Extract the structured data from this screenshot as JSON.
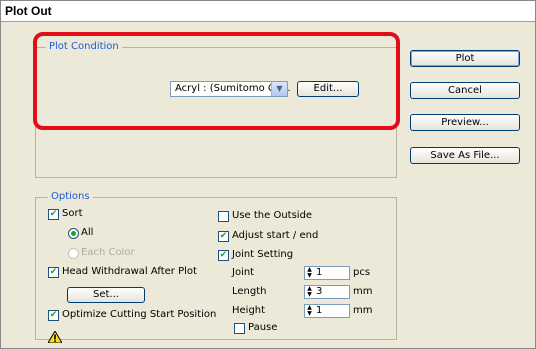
{
  "window": {
    "title": "Plot Out"
  },
  "plot_condition": {
    "legend": "Plot Condition",
    "material_select": {
      "value": "Acryl : (Sumitomo Ch..."
    },
    "edit_button": "Edit..."
  },
  "side_buttons": {
    "plot": "Plot",
    "cancel": "Cancel",
    "preview": "Preview...",
    "save_as_file": "Save As File..."
  },
  "options": {
    "legend": "Options",
    "sort": {
      "label": "Sort",
      "checked": true
    },
    "all": {
      "label": "All",
      "selected": true
    },
    "each_color": {
      "label": "Each Color",
      "enabled": false
    },
    "head_withdrawal": {
      "label": "Head Withdrawal After Plot",
      "checked": true
    },
    "set_button": "Set...",
    "optimize": {
      "label": "Optimize Cutting Start Position",
      "checked": true
    },
    "use_outside": {
      "label": "Use the Outside",
      "checked": false
    },
    "adjust_start_end": {
      "label": "Adjust start / end",
      "checked": true
    },
    "joint_setting": {
      "label": "Joint Setting",
      "checked": true
    },
    "joint": {
      "label": "Joint",
      "value": "1",
      "unit": "pcs"
    },
    "length": {
      "label": "Length",
      "value": "3",
      "unit": "mm"
    },
    "height": {
      "label": "Height",
      "value": "1",
      "unit": "mm"
    },
    "pause": {
      "label": "Pause",
      "checked": false
    }
  },
  "colors": {
    "highlight": "#e10d1b",
    "legend_text": "#1c5bd6",
    "dialog_bg": "#ece9d8"
  }
}
